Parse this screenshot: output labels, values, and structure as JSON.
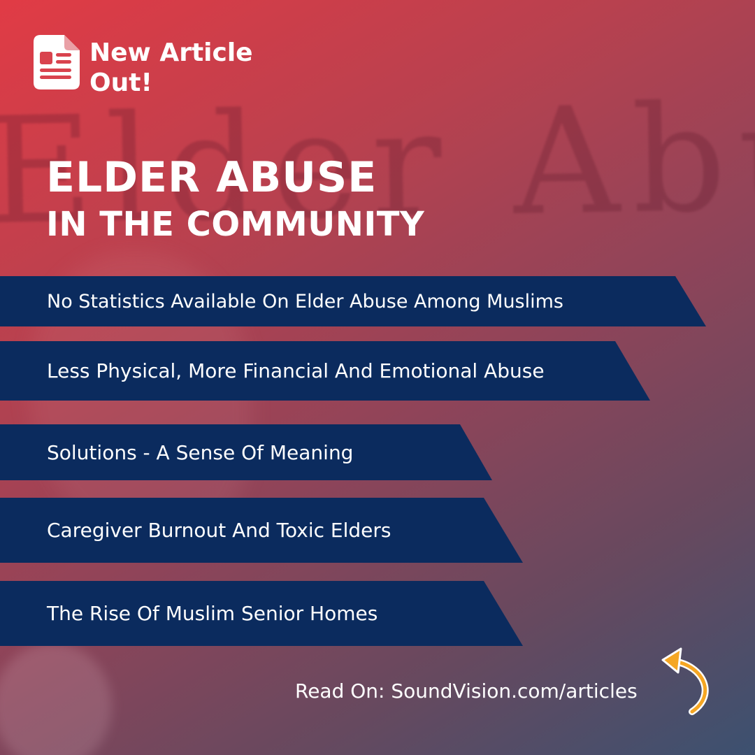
{
  "badge": {
    "icon": "document-icon",
    "line1": "New Article",
    "line2": "Out!"
  },
  "background": {
    "handwriting": "Elder Abuse"
  },
  "title": {
    "line1": "ELDER ABUSE",
    "line2": "IN THE COMMUNITY"
  },
  "items": [
    "No Statistics Available On Elder Abuse Among Muslims",
    "Less Physical, More Financial And Emotional Abuse",
    "Solutions - A Sense Of Meaning",
    "Caregiver Burnout And Toxic Elders",
    "The Rise Of Muslim Senior Homes"
  ],
  "footer": {
    "read_on": "Read On: SoundVision.com/articles",
    "arrow_icon": "curved-arrow-icon"
  },
  "colors": {
    "banner": "#0b2b5e",
    "accent_arrow": "#f5a623",
    "gradient_start": "#e13b45",
    "gradient_end": "#3c5170"
  }
}
